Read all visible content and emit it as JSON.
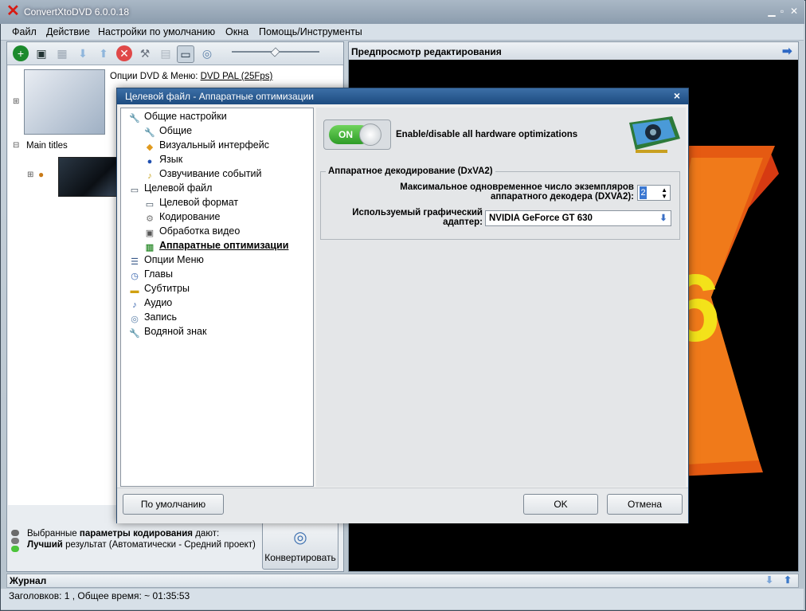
{
  "app": {
    "title": "ConvertXtoDVD 6.0.0.18"
  },
  "menu": [
    "Файл",
    "Действие",
    "Настройки по умолчанию",
    "Окна",
    "Помощь/Инструменты"
  ],
  "toolbar_icons": [
    "add-icon",
    "save-icon",
    "grid-icon",
    "down-arrow-icon",
    "up-arrow-icon",
    "delete-icon",
    "tools-icon",
    "list-icon",
    "monitor-icon",
    "disc-icon"
  ],
  "left": {
    "dvd_options_label": "Опции DVD & Меню:",
    "dvd_options_value": "DVD PAL (25Fps)",
    "main_titles": "Main titles"
  },
  "status_panel": {
    "line1_pre": "Выбранные",
    "line1_bold": "параметры кодирования",
    "line1_post": "дают:",
    "line2_bold": "Лучший",
    "line2_post": "результат (Автоматически - Средний проект)",
    "convert": "Конвертировать"
  },
  "preview": {
    "title": "Предпросмотр редактирования"
  },
  "journal": {
    "title": "Журнал"
  },
  "statusbar": {
    "text": "Заголовков: 1 , Общее время: ~ 01:35:53"
  },
  "dialog": {
    "title": "Целевой файл - Аппаратные оптимизации",
    "tree": [
      {
        "label": "Общие настройки",
        "level": 0,
        "icon": "tools-icon"
      },
      {
        "label": "Общие",
        "level": 1,
        "icon": "tools-icon"
      },
      {
        "label": "Визуальный интерфейс",
        "level": 1,
        "icon": "palette-icon"
      },
      {
        "label": "Язык",
        "level": 1,
        "icon": "globe-icon"
      },
      {
        "label": "Озвучивание событий",
        "level": 1,
        "icon": "sound-icon"
      },
      {
        "label": "Целевой файл",
        "level": 0,
        "icon": "monitor-icon"
      },
      {
        "label": "Целевой формат",
        "level": 1,
        "icon": "monitor-icon"
      },
      {
        "label": "Кодирование",
        "level": 1,
        "icon": "gear-icon"
      },
      {
        "label": "Обработка видео",
        "level": 1,
        "icon": "video-icon"
      },
      {
        "label": "Аппаратные оптимизации",
        "level": 1,
        "icon": "chip-icon",
        "selected": true
      },
      {
        "label": "Опции Меню",
        "level": 0,
        "icon": "menu-icon"
      },
      {
        "label": "Главы",
        "level": 0,
        "icon": "clock-icon"
      },
      {
        "label": "Субтитры",
        "level": 0,
        "icon": "subtitle-icon"
      },
      {
        "label": "Аудио",
        "level": 0,
        "icon": "music-icon"
      },
      {
        "label": "Запись",
        "level": 0,
        "icon": "disc-icon"
      },
      {
        "label": "Водяной знак",
        "level": 0,
        "icon": "tools-icon"
      }
    ],
    "toggle_label": "ON",
    "toggle_text": "Enable/disable all hardware optimizations",
    "group_title": "Аппаратное декодирование (DxVA2)",
    "max_instances_label_1": "Максимальное одновременное число экземпляров",
    "max_instances_label_2": "аппаратного декодера (DXVA2):",
    "max_instances_value": "2",
    "adapter_label_1": "Используемый графический",
    "adapter_label_2": "адаптер:",
    "adapter_value": "NVIDIA GeForce GT 630",
    "btn_default": "По умолчанию",
    "btn_ok": "OK",
    "btn_cancel": "Отмена"
  }
}
